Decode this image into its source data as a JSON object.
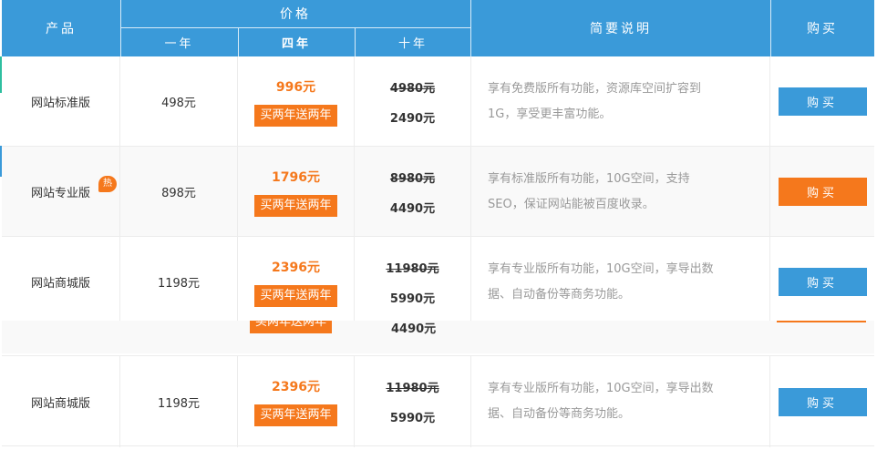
{
  "header": {
    "product": "产品",
    "price": "价格",
    "year1": "一年",
    "year4": "四年",
    "year10": "十年",
    "desc": "简要说明",
    "buy": "购买"
  },
  "rows": [
    {
      "name": "网站标准版",
      "hot": "",
      "price1": "498元",
      "price4": "996元",
      "promo": "买两年送两年",
      "price10_old": "4980元",
      "price10_new": "2490元",
      "desc_line1": "享有免费版所有功能，资源库空间扩容到",
      "desc_line2": "1G，享受更丰富功能。",
      "buy_label": "购买",
      "buy_color": "#3a9ad9"
    },
    {
      "name": "网站专业版",
      "hot": "热",
      "price1": "898元",
      "price4": "1796元",
      "promo": "买两年送两年",
      "price10_old": "8980元",
      "price10_new": "4490元",
      "desc_line1": "享有标准版所有功能，10G空间，支持",
      "desc_line2": "SEO，保证网站能被百度收录。",
      "buy_label": "购买",
      "buy_color": "#f5781c"
    },
    {
      "name": "网站商城版",
      "hot": "",
      "price1": "1198元",
      "price4": "2396元",
      "promo": "买两年送两年",
      "price10_old": "11980元",
      "price10_new": "5990元",
      "desc_line1": "享有专业版所有功能，10G空间，享导出数",
      "desc_line2": "据、自动备份等商务功能。",
      "buy_label": "购买",
      "buy_color": "#3a9ad9"
    }
  ],
  "ghost": {
    "promo": "买两年送两年",
    "price10_new": "4490元"
  },
  "bottom_row": {
    "name": "网站商城版",
    "price1": "1198元",
    "price4": "2396元",
    "promo": "买两年送两年",
    "price10_old": "11980元",
    "price10_new": "5990元",
    "desc_line1": "享有专业版所有功能，10G空间，享导出数",
    "desc_line2": "据、自动备份等商务功能。",
    "buy_label": "购买"
  },
  "colors": {
    "header_blue": "#3a9ad9",
    "accent_orange": "#f5781c"
  }
}
